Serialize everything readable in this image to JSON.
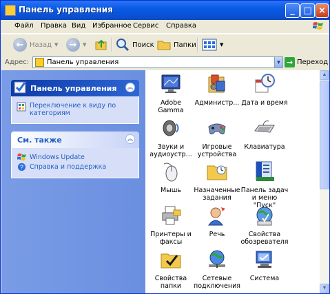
{
  "window": {
    "title": "Панель управления",
    "controls": {
      "minimize": "_",
      "maximize": "□",
      "close": "×"
    }
  },
  "menu": [
    "Файл",
    "Правка",
    "Вид",
    "Избранное",
    "Сервис",
    "Справка"
  ],
  "toolbar": {
    "back": "Назад",
    "search": "Поиск",
    "folders": "Папки"
  },
  "address": {
    "label": "Адрес:",
    "value": "Панель управления",
    "go": "Переход"
  },
  "left": {
    "panel1": {
      "title": "Панель управления",
      "link": "Переключение к виду по категориям"
    },
    "panel2": {
      "title": "См. также",
      "links": [
        "Windows Update",
        "Справка и поддержка"
      ]
    }
  },
  "items": [
    {
      "label": "Adobe Gamma",
      "icon": "monitor-icon",
      "selected": true
    },
    {
      "label": "Администр...",
      "icon": "admin-tools-icon"
    },
    {
      "label": "Дата и время",
      "icon": "clock-icon"
    },
    {
      "label": "Звуки и аудиоустр...",
      "icon": "speaker-icon"
    },
    {
      "label": "Игровые устройства",
      "icon": "gamepad-icon"
    },
    {
      "label": "Клавиатура",
      "icon": "keyboard-icon"
    },
    {
      "label": "Мышь",
      "icon": "mouse-icon"
    },
    {
      "label": "Назначенные задания",
      "icon": "scheduled-tasks-icon"
    },
    {
      "label": "Панель задач и меню \"Пуск\"",
      "icon": "taskbar-icon"
    },
    {
      "label": "Принтеры и факсы",
      "icon": "printer-icon"
    },
    {
      "label": "Речь",
      "icon": "speech-icon"
    },
    {
      "label": "Свойства обозревателя",
      "icon": "internet-options-icon"
    },
    {
      "label": "Свойства папки",
      "icon": "folder-options-icon"
    },
    {
      "label": "Сетевые подключения",
      "icon": "network-icon"
    },
    {
      "label": "Система",
      "icon": "system-icon"
    }
  ]
}
